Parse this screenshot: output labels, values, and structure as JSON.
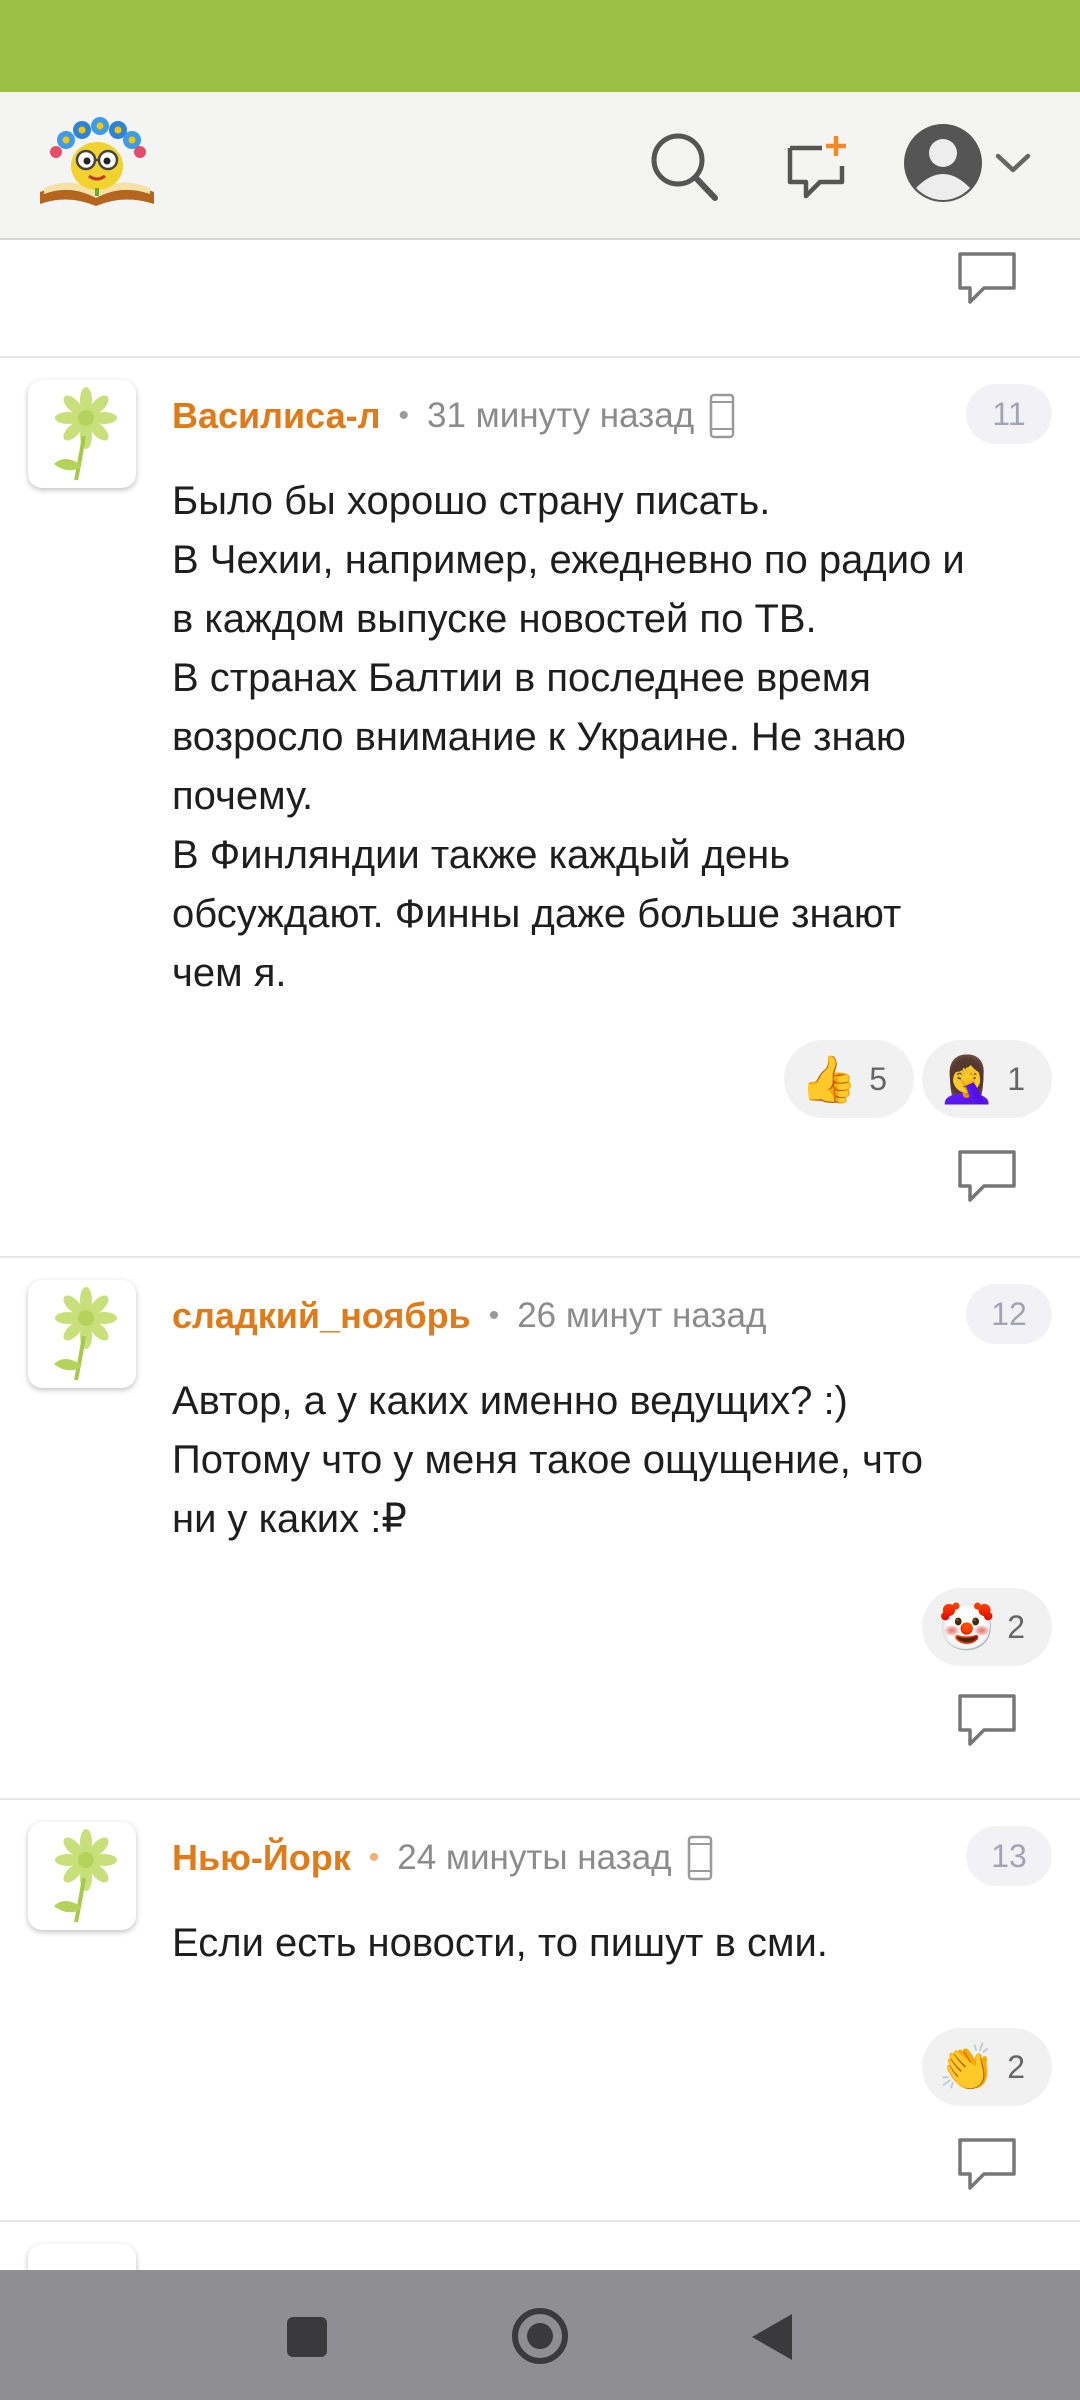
{
  "colors": {
    "status_bar": "#9cc043",
    "author": "#e07b17",
    "nav_bar": "#8e8e93"
  },
  "header": {
    "logo": "site-logo-flower-book",
    "icons": [
      "search-icon",
      "new-post-icon",
      "user-avatar-icon",
      "chevron-down-icon"
    ]
  },
  "comments": [
    {
      "author": "Василиса-л",
      "time": "31 минуту назад",
      "mobile": true,
      "number": "11",
      "text": [
        "Было бы хорошо страну писать.",
        "В Чехии, например, ежедневно по радио и",
        "в каждом выпуске новостей по ТВ.",
        "В странах Балтии в последнее время",
        "возросло внимание к Украине. Не знаю",
        "почему.",
        "В Финляндии также каждый день",
        "обсуждают. Финны даже больше знают",
        "чем я."
      ],
      "reactions": [
        {
          "emoji": "👍",
          "count": "5"
        },
        {
          "emoji": "🤦‍♀️",
          "count": "1"
        }
      ]
    },
    {
      "author": "сладкий_ноябрь",
      "time": "26 минут назад",
      "mobile": false,
      "number": "12",
      "text": [
        "Автор, а у каких именно ведущих? :)",
        "Потому что у меня такое ощущение, что",
        "ни у каких :₽"
      ],
      "reactions": [
        {
          "emoji": "🤡",
          "count": "2"
        }
      ]
    },
    {
      "author": "Нью-Йорк",
      "time": "24 минуты назад",
      "mobile": true,
      "number": "13",
      "text": [
        "Если есть новости, то пишут в сми."
      ],
      "reactions": [
        {
          "emoji": "👏",
          "count": "2"
        }
      ]
    }
  ],
  "navbar": {
    "buttons": [
      "recents-square-icon",
      "home-circle-icon",
      "back-triangle-icon"
    ]
  }
}
